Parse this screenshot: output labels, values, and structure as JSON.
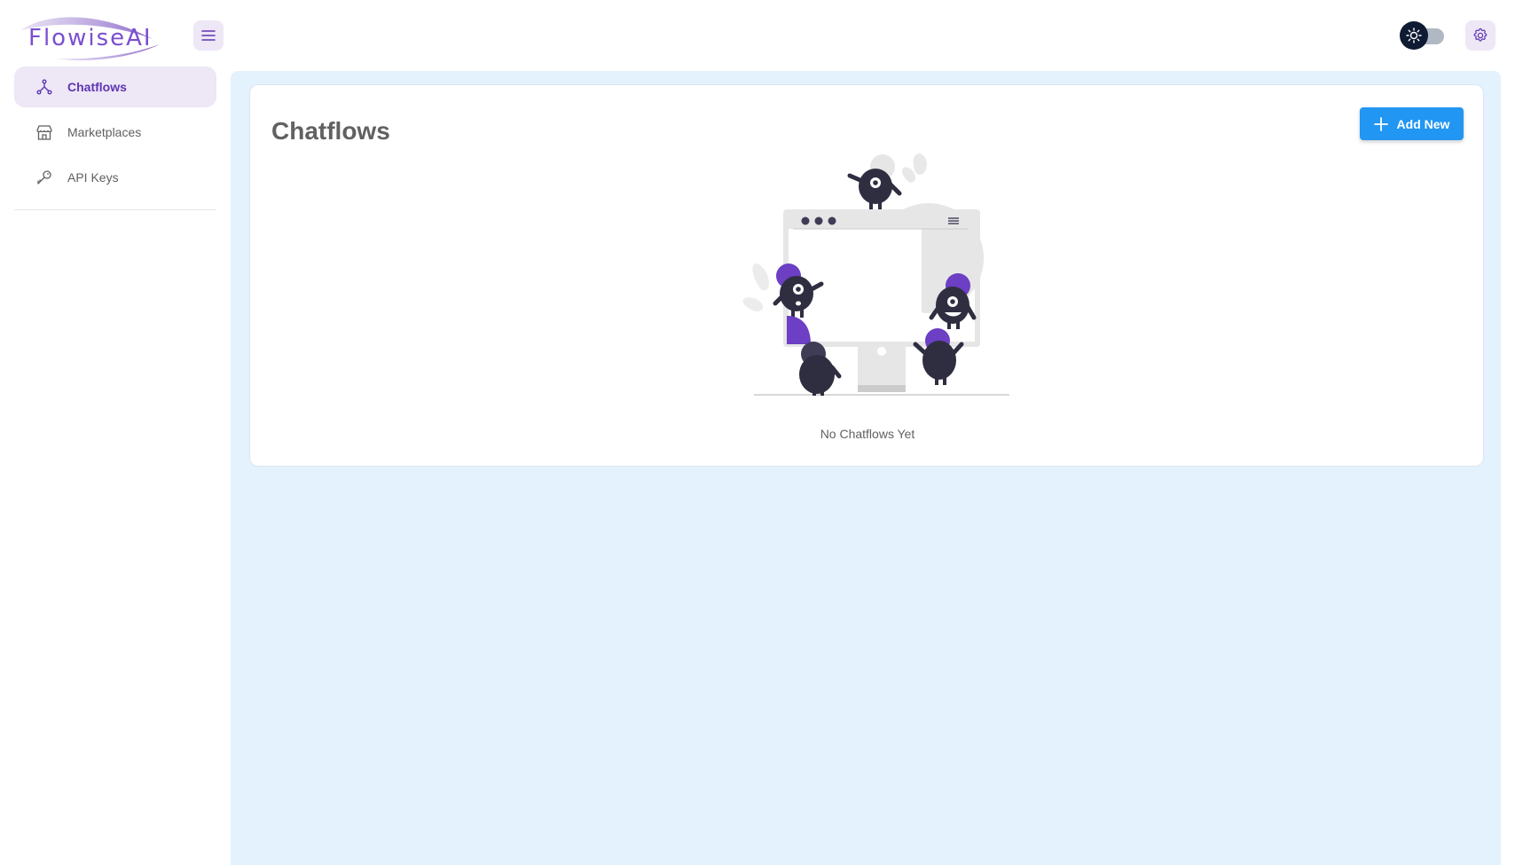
{
  "header": {
    "logo_text": "FlowiseAI"
  },
  "sidebar": {
    "items": [
      {
        "label": "Chatflows",
        "icon": "hierarchy-icon",
        "active": true
      },
      {
        "label": "Marketplaces",
        "icon": "building-store-icon",
        "active": false
      },
      {
        "label": "API Keys",
        "icon": "key-icon",
        "active": false
      }
    ]
  },
  "main": {
    "title": "Chatflows",
    "add_button_label": "Add New",
    "empty_state_text": "No Chatflows Yet"
  },
  "colors": {
    "accent_purple": "#5e35b1",
    "active_bg": "#ede7f6",
    "primary_blue": "#2196f3",
    "main_bg": "#e3f2fd",
    "illustration_purple": "#6c3fc4",
    "illustration_dark": "#2f2e41"
  }
}
